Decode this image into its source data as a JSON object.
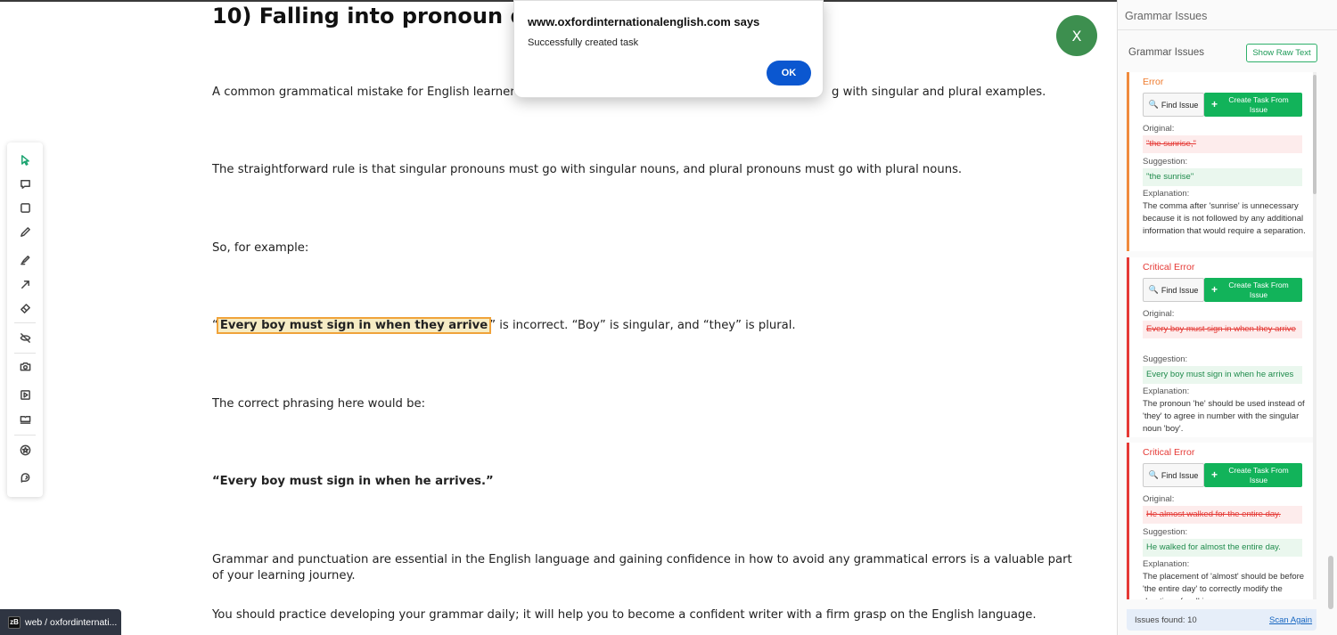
{
  "article": {
    "heading": "10) Falling into pronoun disa",
    "p1": "A common grammatical mistake for English learners is",
    "p1_tail": "g with singular and plural examples.",
    "p2": "The straightforward rule is that singular pronouns must go with singular nouns, and plural pronouns must go with plural nouns.",
    "p3": "So, for example:",
    "p4_open_quote": "“",
    "p4_highlight": "Every boy must sign in when they arrive",
    "p4_rest": "” is incorrect. “Boy” is singular, and “they” is plural.",
    "p5": "The correct phrasing here would be:",
    "p6": "“Every boy must sign in when he arrives.”",
    "p7": "Grammar and punctuation are essential in the English language and gaining confidence in how to avoid any grammatical errors is a valuable part of your learning journey.",
    "p8": "You should practice developing your grammar daily; it will help you to become a confident writer with a firm grasp on the English language."
  },
  "dialog": {
    "title": "www.oxfordinternationalenglish.com says",
    "message": "Successfully created task",
    "ok_label": "OK"
  },
  "close_button": {
    "label": "X",
    "color": "#3d8f4f"
  },
  "tools": [
    "pointer-icon",
    "comment-icon",
    "rectangle-icon",
    "pencil-icon",
    "highlighter-icon",
    "arrow-icon",
    "eraser-icon",
    "hide-icon",
    "camera-icon",
    "record-icon",
    "book-icon",
    "star-icon",
    "feedback-icon"
  ],
  "bottom_tab": {
    "logo": "zB",
    "label": "web / oxfordinternati..."
  },
  "panel": {
    "title": "Grammar Issues",
    "subtitle": "Grammar Issues",
    "raw_button": "Show Raw Text",
    "find_label": "Find Issue",
    "create_label": "Create Task From Issue",
    "original_label": "Original:",
    "suggestion_label": "Suggestion:",
    "explanation_label": "Explanation:",
    "issues": [
      {
        "type": "Error",
        "original": "\"the sunrise,\"",
        "suggestion": "\"the sunrise\"",
        "explanation": "The comma after 'sunrise' is unnecessary because it is not followed by any additional information that would require a separation."
      },
      {
        "type": "Critical Error",
        "original": "Every boy must sign in when they arrive",
        "suggestion": "Every boy must sign in when he arrives",
        "explanation": "The pronoun 'he' should be used instead of 'they' to agree in number with the singular noun 'boy'."
      },
      {
        "type": "Critical Error",
        "original": "He almost walked for the entire day.",
        "suggestion": "He walked for almost the entire day.",
        "explanation": "The placement of 'almost' should be before 'the entire day' to correctly modify the duration of walking."
      }
    ],
    "issues_found": "Issues found: 10",
    "scan_again": "Scan Again"
  },
  "colors": {
    "error": "#ef7a2c",
    "critical": "#e53935",
    "green": "#12b35a",
    "accent_blue": "#0b57d0"
  }
}
